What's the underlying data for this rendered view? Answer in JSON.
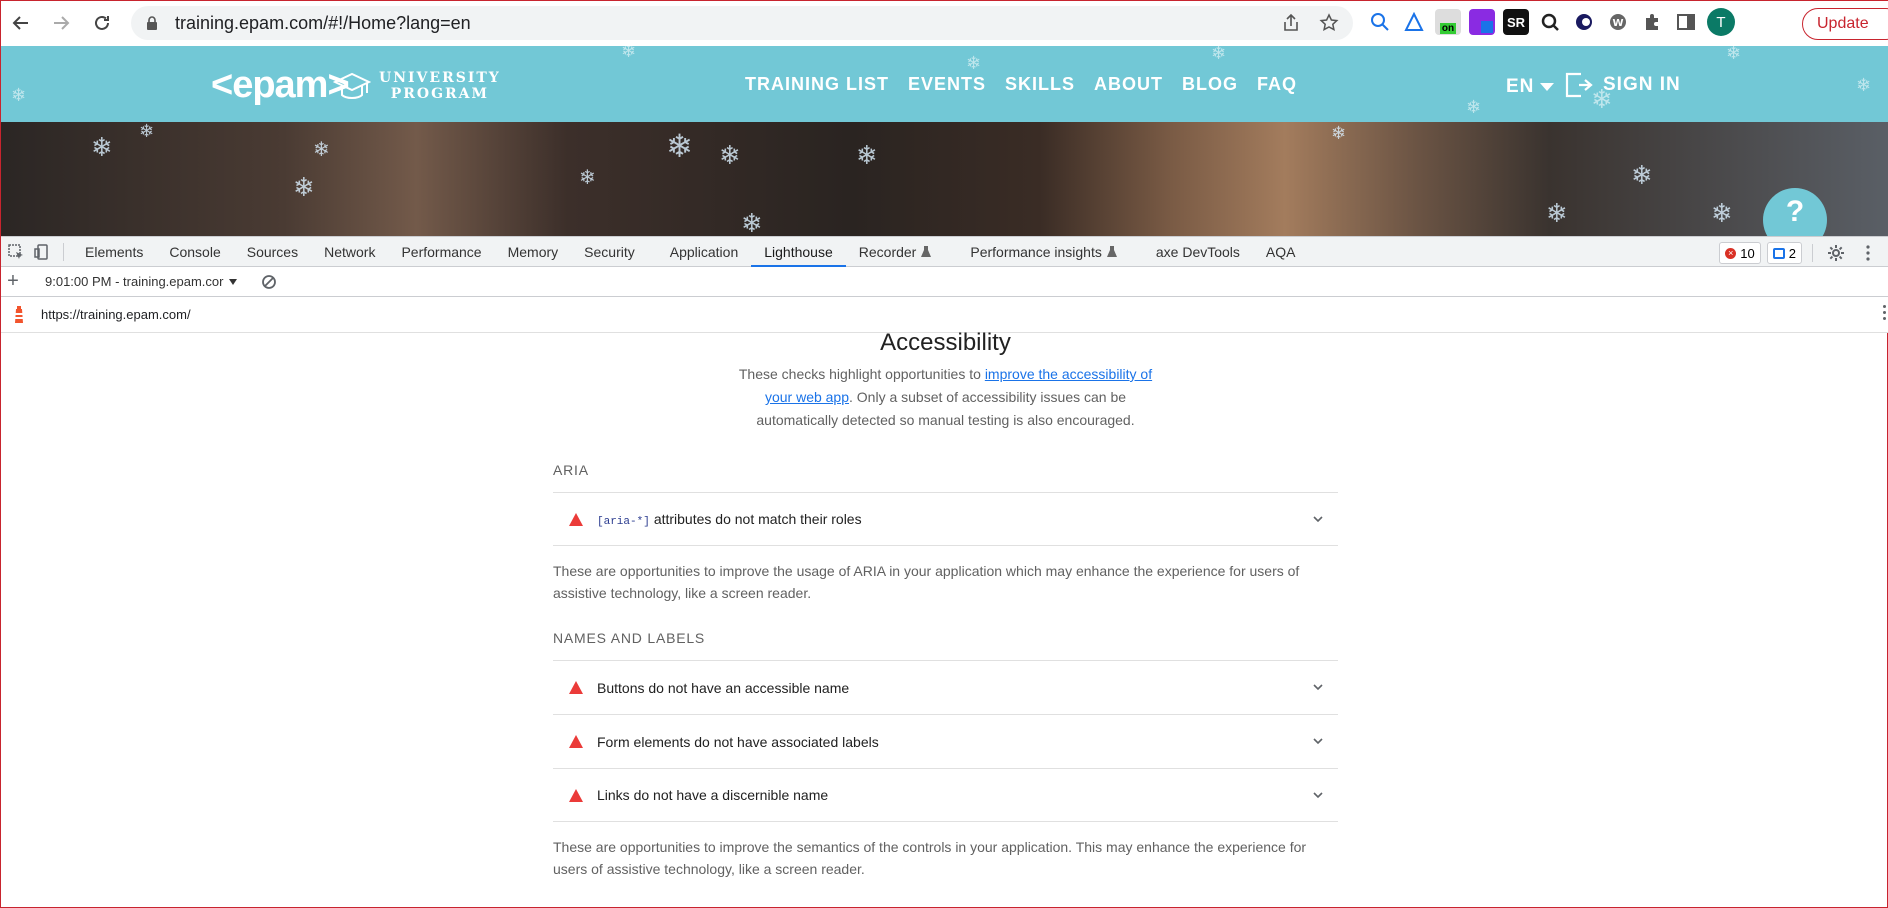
{
  "browser": {
    "url": "training.epam.com/#!/Home?lang=en",
    "avatar_letter": "T",
    "update_label": "Update",
    "ext_sr_label": "SR"
  },
  "site": {
    "logo_text": "<epam>",
    "univ_line1": "UNIVERSITY",
    "univ_line2": "PROGRAM",
    "nav": [
      "TRAINING LIST",
      "EVENTS",
      "SKILLS",
      "ABOUT",
      "BLOG",
      "FAQ"
    ],
    "lang": "EN",
    "signin": "SIGN IN",
    "help": "?"
  },
  "devtools": {
    "tabs": [
      "Elements",
      "Console",
      "Sources",
      "Network",
      "Performance",
      "Memory",
      "Security",
      "Application",
      "Lighthouse",
      "Recorder",
      "Performance insights",
      "axe DevTools",
      "AQA"
    ],
    "active_tab": "Lighthouse",
    "error_count": "10",
    "message_count": "2"
  },
  "lighthouse": {
    "report_label": "9:01:00 PM - training.epam.cor",
    "url": "https://training.epam.com/",
    "section_title": "Accessibility",
    "desc_before": "These checks highlight opportunities to ",
    "desc_link": "improve the accessibility of your web app",
    "desc_after": ". Only a subset of accessibility issues can be automatically detected so manual testing is also encouraged.",
    "groups": [
      {
        "title": "ARIA",
        "audits": [
          {
            "code": "[aria-*]",
            "title": "attributes do not match their roles"
          }
        ],
        "description": "These are opportunities to improve the usage of ARIA in your application which may enhance the experience for users of assistive technology, like a screen reader."
      },
      {
        "title": "NAMES AND LABELS",
        "audits": [
          {
            "title": "Buttons do not have an accessible name"
          },
          {
            "title": "Form elements do not have associated labels"
          },
          {
            "title": "Links do not have a discernible name"
          }
        ],
        "description": "These are opportunities to improve the semantics of the controls in your application. This may enhance the experience for users of assistive technology, like a screen reader."
      }
    ]
  },
  "colors": {
    "site_header": "#72c8d6",
    "fail": "#eb3b39",
    "link": "#1a73e8",
    "update": "#c8242e"
  }
}
